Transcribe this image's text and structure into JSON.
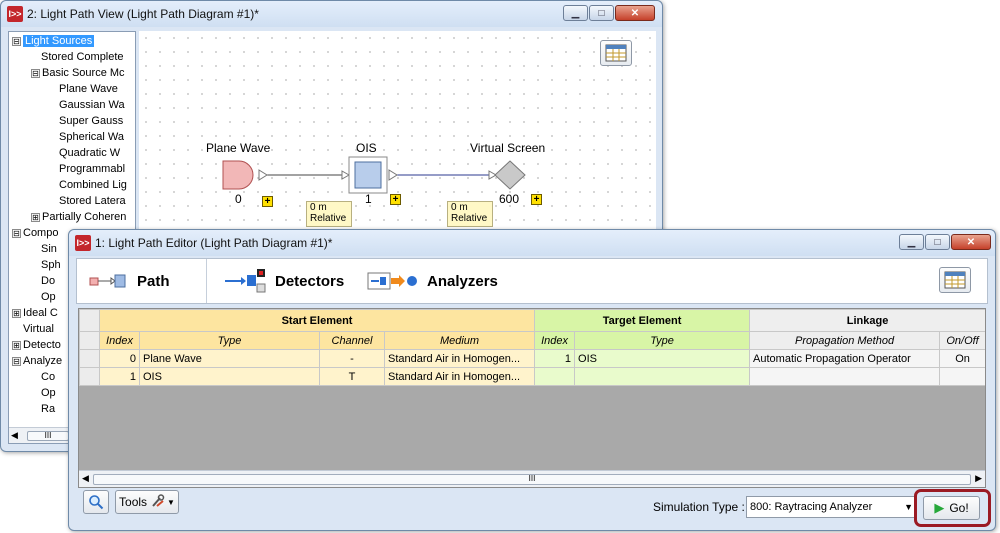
{
  "colors": {
    "highlight_border": "#9b1b24",
    "start_header": "#fde5a0",
    "target_header": "#d8f5a6",
    "link_header": "#eeeeee",
    "selection": "#3399ff"
  },
  "back_window": {
    "app_icon": "I>>",
    "title": "2: Light Path View (Light Path Diagram #1)*",
    "window_controls": {
      "minimize": "minimize-icon",
      "maximize": "maximize-icon",
      "close": "close-icon"
    },
    "tree": [
      {
        "label": "Light Sources",
        "expander": "⊟",
        "selected": true
      },
      {
        "label": "Stored Complete",
        "expander": ""
      },
      {
        "label": "Basic Source Mc",
        "expander": "⊟"
      },
      {
        "label": "Plane Wave",
        "expander": ""
      },
      {
        "label": "Gaussian Wa",
        "expander": ""
      },
      {
        "label": "Super Gauss",
        "expander": ""
      },
      {
        "label": "Spherical Wa",
        "expander": ""
      },
      {
        "label": "Quadratic W",
        "expander": ""
      },
      {
        "label": "Programmabl",
        "expander": ""
      },
      {
        "label": "Combined Lig",
        "expander": ""
      },
      {
        "label": "Stored Latera",
        "expander": ""
      },
      {
        "label": "Partially Coheren",
        "expander": "⊞"
      },
      {
        "label": "Compo",
        "expander": "⊟"
      },
      {
        "label": "Sin",
        "expander": ""
      },
      {
        "label": "Sph",
        "expander": ""
      },
      {
        "label": "Do",
        "expander": ""
      },
      {
        "label": "Op",
        "expander": ""
      },
      {
        "label": "Ideal C",
        "expander": "⊞"
      },
      {
        "label": "Virtual",
        "expander": ""
      },
      {
        "label": "Detecto",
        "expander": "⊞"
      },
      {
        "label": "Analyze",
        "expander": "⊟"
      },
      {
        "label": "Co",
        "expander": ""
      },
      {
        "label": "Op",
        "expander": ""
      },
      {
        "label": "Ra",
        "expander": ""
      }
    ],
    "tree_scroll_thumb": "III",
    "diagram": {
      "nodes": [
        {
          "label": "Plane Wave",
          "index": "0"
        },
        {
          "label": "OIS",
          "index": "1"
        },
        {
          "label": "Virtual Screen",
          "index": "600"
        }
      ],
      "expand_symbol": "+",
      "distance_labels": [
        {
          "value": "0 m",
          "mode": "Relative"
        },
        {
          "value": "0 m",
          "mode": "Relative"
        }
      ]
    }
  },
  "front_window": {
    "app_icon": "I>>",
    "title": "1: Light Path Editor (Light Path Diagram #1)*",
    "tabs": [
      {
        "label": "Path",
        "icon": "path-icon",
        "active": true
      },
      {
        "label": "Detectors",
        "icon": "detectors-icon",
        "active": false
      },
      {
        "label": "Analyzers",
        "icon": "analyzers-icon",
        "active": false
      }
    ],
    "table": {
      "groups": {
        "start": "Start Element",
        "target": "Target Element",
        "linkage": "Linkage"
      },
      "columns": [
        "Index",
        "Type",
        "Channel",
        "Medium",
        "Index",
        "Type",
        "Propagation Method",
        "On/Off"
      ],
      "rows": [
        {
          "start_index": "0",
          "start_type": "Plane Wave",
          "channel": "-",
          "medium": "Standard Air in Homogen...",
          "target_index": "1",
          "target_type": "OIS",
          "method": "Automatic Propagation Operator",
          "onoff": "On"
        },
        {
          "start_index": "1",
          "start_type": "OIS",
          "channel": "T",
          "medium": "Standard Air in Homogen...",
          "target_index": "",
          "target_type": "",
          "method": "",
          "onoff": ""
        }
      ],
      "scroll_thumb": "III"
    },
    "footer": {
      "tools_label": "Tools",
      "simulation_type_label": "Simulation Type :",
      "simulation_type_value": "800: Raytracing Analyzer",
      "go_label": "Go!"
    }
  }
}
